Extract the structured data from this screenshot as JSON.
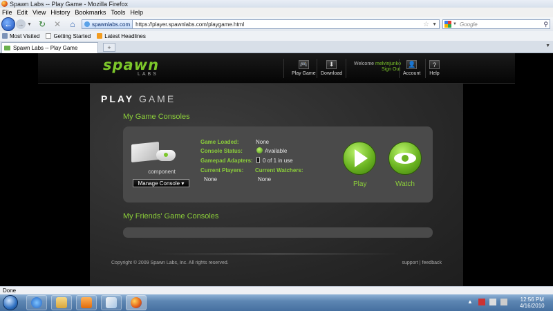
{
  "window": {
    "title": "Spawn Labs -- Play Game - Mozilla Firefox"
  },
  "menu": [
    "File",
    "Edit",
    "View",
    "History",
    "Bookmarks",
    "Tools",
    "Help"
  ],
  "nav": {
    "site_identity": "spawnlabs.com",
    "url": "https://player.spawnlabs.com/playgame.html",
    "search_placeholder": "Google"
  },
  "bookmarks": [
    "Most Visited",
    "Getting Started",
    "Latest Headlines"
  ],
  "tab": {
    "label": "Spawn Labs -- Play Game",
    "new_tab": "+"
  },
  "site": {
    "logo_main": "spawn",
    "logo_sub": "LABS",
    "nav": {
      "play_game": "Play Game",
      "download": "Download",
      "account": "Account",
      "help": "Help"
    },
    "welcome_prefix": "Welcome ",
    "username": "melvinjunko",
    "sign_out": "Sign Out"
  },
  "page": {
    "title_bold": "PLAY",
    "title_light": "GAME",
    "my_consoles_heading": "My Game Consoles",
    "friends_consoles_heading": "My Friends' Game Consoles"
  },
  "console": {
    "name": "component",
    "manage_button": "Manage Console ▾",
    "game_loaded_label": "Game Loaded:",
    "game_loaded_value": "None",
    "status_label": "Console Status:",
    "status_value": "Available",
    "gamepad_label": "Gamepad Adapters:",
    "gamepad_value": "0 of 1 in use",
    "players_label": "Current Players:",
    "players_value": "None",
    "watchers_label": "Current Watchers:",
    "watchers_value": "None",
    "play_label": "Play",
    "watch_label": "Watch"
  },
  "footer": {
    "copyright": "Copyright © 2009 Spawn Labs, Inc. All rights reserved.",
    "support": "support",
    "feedback": "feedback",
    "divider": "|"
  },
  "status_bar": "Done",
  "clock": {
    "time": "12:56 PM",
    "date": "4/16/2010"
  },
  "colors": {
    "accent": "#8ccf3a",
    "panel": "#4a4a4a"
  }
}
